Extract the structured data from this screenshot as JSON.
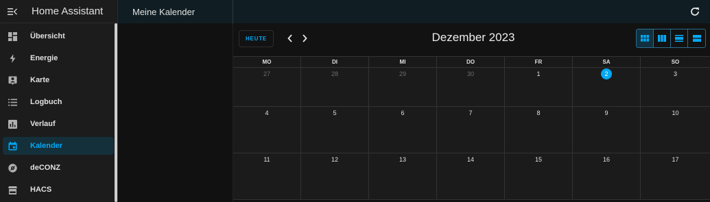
{
  "app": {
    "title": "Home Assistant",
    "page_title": "Meine Kalender",
    "accent_color": "#03a9f4"
  },
  "sidebar": {
    "items": [
      {
        "label": "Übersicht",
        "icon": "dashboard-icon"
      },
      {
        "label": "Energie",
        "icon": "lightning-icon"
      },
      {
        "label": "Karte",
        "icon": "map-person-icon"
      },
      {
        "label": "Logbuch",
        "icon": "list-icon"
      },
      {
        "label": "Verlauf",
        "icon": "chart-icon"
      },
      {
        "label": "Kalender",
        "icon": "calendar-icon",
        "active": true
      },
      {
        "label": "deCONZ",
        "icon": "deconz-icon"
      },
      {
        "label": "HACS",
        "icon": "hacs-icon"
      }
    ]
  },
  "calendar": {
    "today_label": "HEUTE",
    "month_title": "Dezember 2023",
    "weekdays": [
      "MO",
      "DI",
      "MI",
      "DO",
      "FR",
      "SA",
      "SO"
    ],
    "weeks": [
      [
        "27",
        "28",
        "29",
        "30",
        "1",
        "2",
        "3"
      ],
      [
        "4",
        "5",
        "6",
        "7",
        "8",
        "9",
        "10"
      ],
      [
        "11",
        "12",
        "13",
        "14",
        "15",
        "16",
        "17"
      ]
    ],
    "today_day": "2",
    "views": [
      "month-view-icon",
      "week-view-icon",
      "day-view-icon",
      "list-view-icon"
    ]
  }
}
